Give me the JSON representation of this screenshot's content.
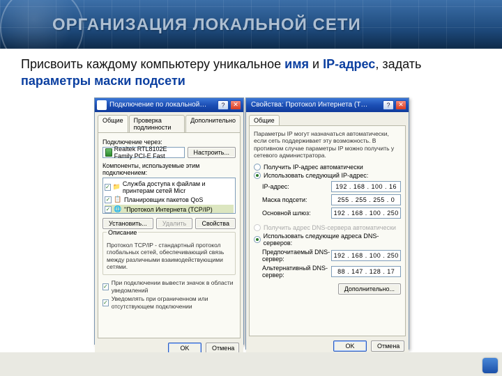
{
  "banner": {
    "title": "ОРГАНИЗАЦИЯ ЛОКАЛЬНОЙ СЕТИ"
  },
  "intro": {
    "pre": "Присвоить каждому компьютеру уникальное ",
    "name": "имя",
    "mid": " и ",
    "ip": "IP-адрес",
    "post": ", задать ",
    "mask": "параметры маски подсети"
  },
  "win1": {
    "title": "Подключение по локальной…",
    "tabs": [
      "Общие",
      "Проверка подлинности",
      "Дополнительно"
    ],
    "connect_label": "Подключение через:",
    "adapter": "Realtek RTL8102E Family PCI-E Fast",
    "configure_btn": "Настроить...",
    "components_label": "Компоненты, используемые этим подключением:",
    "components": [
      "Служба доступа к файлам и принтерам сетей Micr",
      "Планировщик пакетов QoS",
      "\"Протокол Интернета (TCP/IP)"
    ],
    "install_btn": "Установить...",
    "uninstall_btn": "Удалить",
    "props_btn": "Свойства",
    "desc_legend": "Описание",
    "description": "Протокол TCP/IP - стандартный протокол глобальных сетей, обеспечивающий связь между различными взаимодействующими сетями.",
    "tray_chk": "При подключении вывести значок в области уведомлений",
    "limited_chk": "Уведомлять при ограниченном или отсутствующем подключении",
    "ok": "OK",
    "cancel": "Отмена"
  },
  "win2": {
    "title": "Свойства: Протокол Интернета (T…",
    "tab": "Общие",
    "info": "Параметры IP могут назначаться автоматически, если сеть поддерживает эту возможность. В противном случае параметры IP можно получить у сетевого администратора.",
    "r_auto_ip": "Получить IP-адрес автоматически",
    "r_manual_ip": "Использовать следующий IP-адрес:",
    "ip_label": "IP-адрес:",
    "ip_value": "192 . 168 . 100 .  16",
    "mask_label": "Маска подсети:",
    "mask_value": "255 . 255 . 255 .   0",
    "gw_label": "Основной шлюз:",
    "gw_value": "192 . 168 . 100 . 250",
    "r_auto_dns": "Получить адрес DNS-сервера автоматически",
    "r_manual_dns": "Использовать следующие адреса DNS-серверов:",
    "dns1_label": "Предпочитаемый DNS-сервер:",
    "dns1_value": "192 . 168 . 100 . 250",
    "dns2_label": "Альтернативный DNS-сервер:",
    "dns2_value": " 88 . 147 . 128 .  17",
    "adv_btn": "Дополнительно...",
    "ok": "OK",
    "cancel": "Отмена"
  }
}
